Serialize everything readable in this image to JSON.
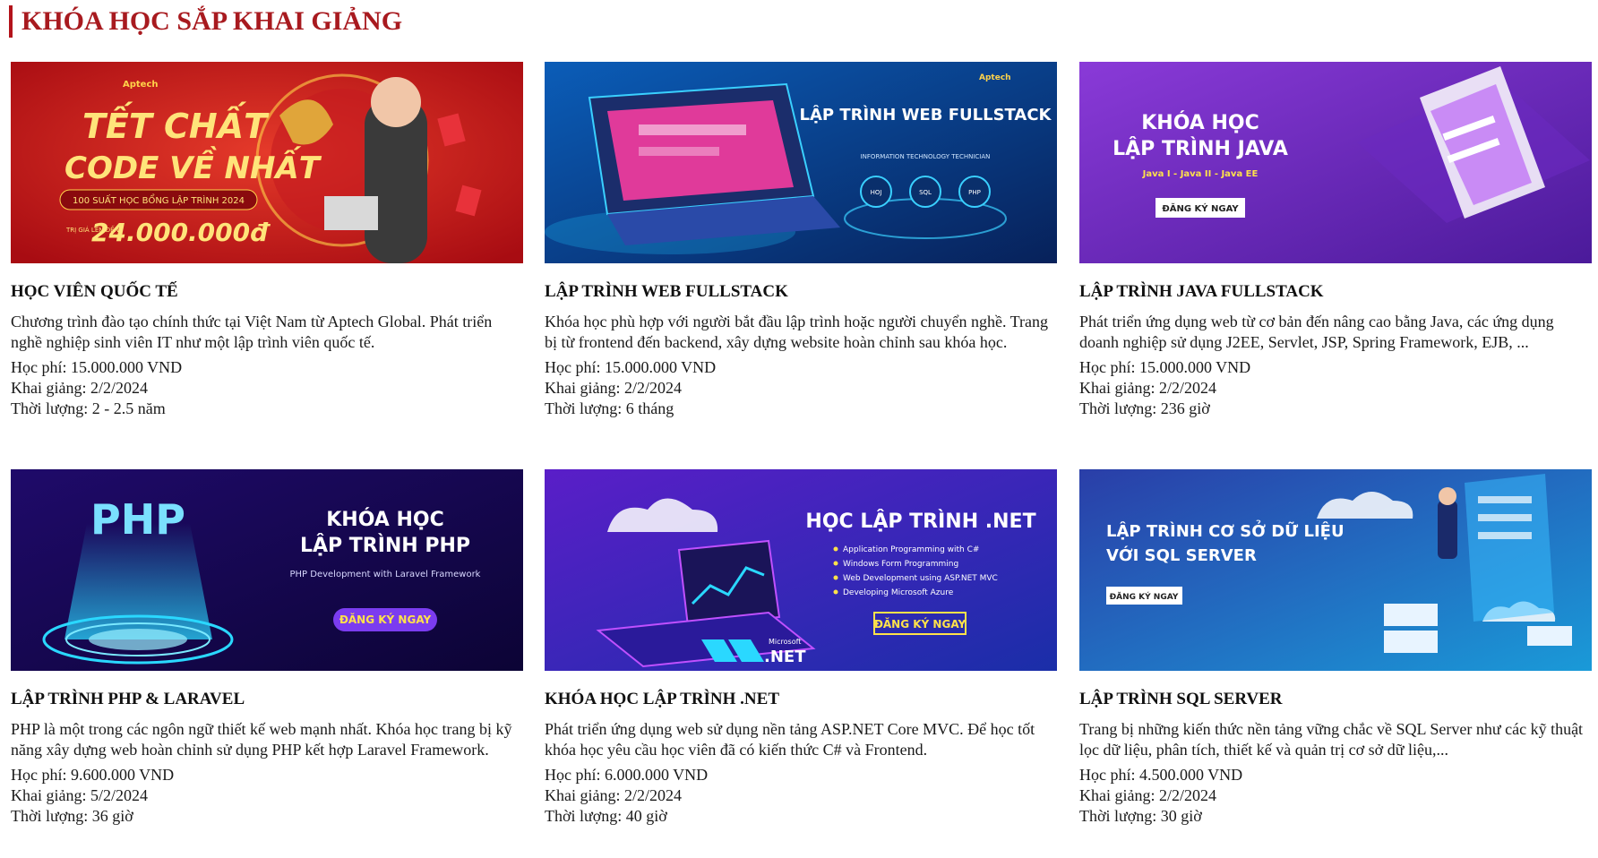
{
  "section": {
    "title": "KHÓA HỌC SẮP KHAI GIẢNG"
  },
  "meta_labels": {
    "fee": "Học phí: ",
    "start": "Khai giảng: ",
    "duration": "Thời lượng: "
  },
  "courses": [
    {
      "title": "HỌC VIÊN QUỐC TẾ",
      "description": "Chương trình đào tạo chính thức tại Việt Nam từ Aptech Global. Phát triển nghề nghiệp sinh viên IT như một lập trình viên quốc tế.",
      "fee": "15.000.000 VND",
      "start": "2/2/2024",
      "duration": "2 - 2.5 năm",
      "banner": {
        "logo": "Aptech",
        "line1": "TẾT CHẤT",
        "line2": "CODE VỀ NHẤT",
        "ribbon": "100 SUẤT HỌC BỔNG LẬP TRÌNH 2024",
        "prize_label": "TRỊ GIÁ LÊN ĐẾN",
        "prize": "24.000.000đ",
        "colors": {
          "bg": "#c8161d",
          "gold": "#ffd34a"
        }
      }
    },
    {
      "title": "LẬP TRÌNH WEB FULLSTACK",
      "description": "Khóa học phù hợp với người bắt đầu lập trình hoặc người chuyển nghề. Trang bị từ frontend đến backend, xây dựng website hoàn chỉnh sau khóa học.",
      "fee": "15.000.000 VND",
      "start": "2/2/2024",
      "duration": "6 tháng",
      "banner": {
        "logo": "Aptech",
        "headline": "LẬP TRÌNH WEB FULLSTACK",
        "sub": "INFORMATION TECHNOLOGY TECHNICIAN",
        "icons": [
          "HOJ",
          "SQL",
          "PHP"
        ],
        "colors": {
          "bg": "#0b3d8c"
        }
      }
    },
    {
      "title": "LẬP TRÌNH JAVA FULLSTACK",
      "description": "Phát triển ứng dụng web từ cơ bản đến nâng cao bằng Java, các ứng dụng doanh nghiệp sử dụng J2EE, Servlet, JSP, Spring Framework, EJB, ...",
      "fee": "15.000.000 VND",
      "start": "2/2/2024",
      "duration": "236 giờ",
      "banner": {
        "line1": "KHÓA HỌC",
        "line2": "LẬP TRÌNH JAVA",
        "sub": "Java I - Java II - Java EE",
        "cta": "ĐĂNG KÝ NGAY",
        "colors": {
          "bg": "#7a2fd0",
          "accent": "#ffe24a"
        }
      }
    },
    {
      "title": "LẬP TRÌNH PHP & LARAVEL",
      "description": "PHP là một trong các ngôn ngữ thiết kế web mạnh nhất. Khóa học trang bị kỹ năng xây dựng web hoàn chỉnh sử dụng PHP kết hợp Laravel Framework.",
      "fee": "9.600.000 VND",
      "start": "5/2/2024",
      "duration": "36 giờ",
      "banner": {
        "logo_text": "PHP",
        "line1": "KHÓA HỌC",
        "line2": "LẬP TRÌNH PHP",
        "sub": "PHP Development with Laravel Framework",
        "cta": "ĐĂNG KÝ NGAY",
        "colors": {
          "bg": "#1a0a5c",
          "accent": "#ffe24a"
        }
      }
    },
    {
      "title": "KHÓA HỌC LẬP TRÌNH .NET",
      "description": "Phát triển ứng dụng web sử dụng nền tảng ASP.NET Core MVC. Để học tốt khóa học yêu cầu học viên đã có kiến thức C# và Frontend.",
      "fee": "6.000.000 VND",
      "start": "2/2/2024",
      "duration": "40 giờ",
      "banner": {
        "headline": "HỌC LẬP TRÌNH .NET",
        "bullets": [
          "Application Programming with C#",
          "Windows Form Programming",
          "Web Development using ASP.NET MVC",
          "Developing Microsoft Azure"
        ],
        "cta": "ĐĂNG KÝ NGAY",
        "brand_small": "Microsoft",
        "brand": ".NET",
        "colors": {
          "bg": "#3a1ca8",
          "accent": "#ffe24a"
        }
      }
    },
    {
      "title": "LẬP TRÌNH SQL SERVER",
      "description": "Trang bị những kiến thức nền tảng vững chắc về SQL Server như các kỹ thuật lọc dữ liệu, phân tích, thiết kế và quản trị cơ sở dữ liệu,...",
      "fee": "4.500.000 VND",
      "start": "2/2/2024",
      "duration": "30 giờ",
      "banner": {
        "line1": "LẬP TRÌNH CƠ SỞ DỮ LIỆU",
        "line2": "VỚI SQL SERVER",
        "cta": "ĐĂNG KÝ NGAY",
        "colors": {
          "bg": "#1c6fae"
        }
      }
    }
  ]
}
